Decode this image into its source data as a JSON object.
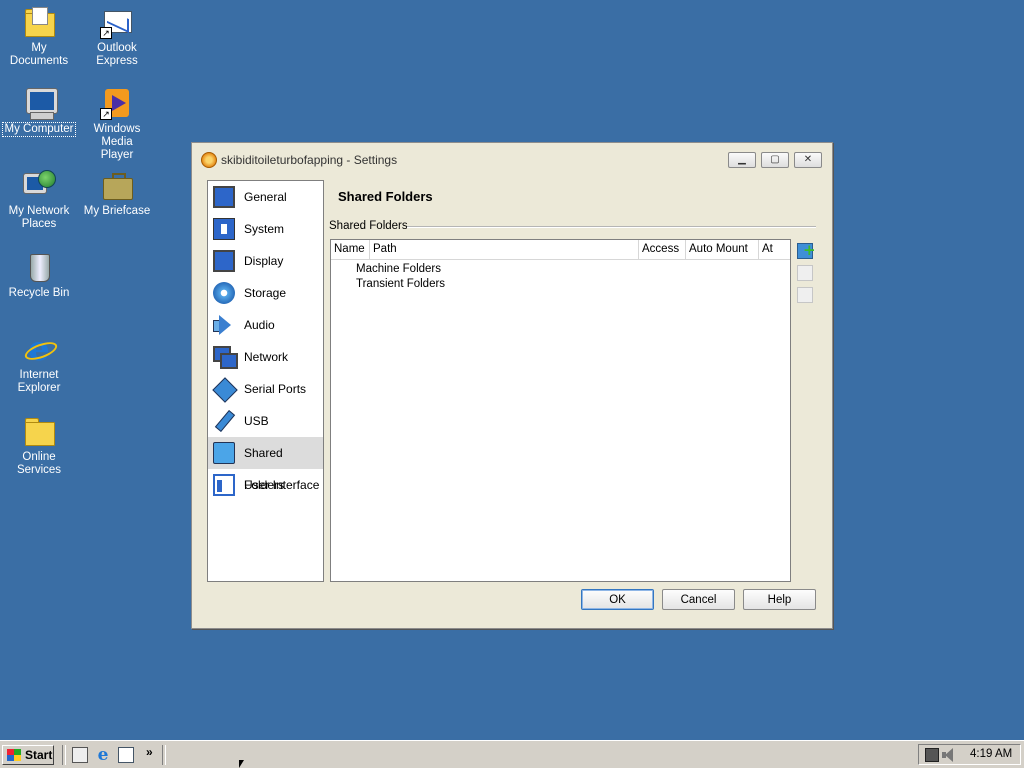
{
  "desktop": {
    "icons": [
      {
        "label": "My Documents"
      },
      {
        "label": "Outlook Express"
      },
      {
        "label": "My Computer"
      },
      {
        "label": "Windows Media Player"
      },
      {
        "label": "My Network Places"
      },
      {
        "label": "My Briefcase"
      },
      {
        "label": "Recycle Bin"
      },
      {
        "label": "Internet Explorer"
      },
      {
        "label": "Online Services"
      }
    ]
  },
  "dialog": {
    "title": "skibiditoileturbofapping - Settings",
    "sidebar": [
      {
        "label": "General",
        "icon": "general-icon"
      },
      {
        "label": "System",
        "icon": "system-icon"
      },
      {
        "label": "Display",
        "icon": "display-icon"
      },
      {
        "label": "Storage",
        "icon": "storage-icon"
      },
      {
        "label": "Audio",
        "icon": "audio-icon"
      },
      {
        "label": "Network",
        "icon": "network-icon"
      },
      {
        "label": "Serial Ports",
        "icon": "serial-ports-icon"
      },
      {
        "label": "USB",
        "icon": "usb-icon"
      },
      {
        "label": "Shared Folders",
        "icon": "shared-folders-icon",
        "selected": true
      },
      {
        "label": "User Interface",
        "icon": "user-interface-icon"
      }
    ],
    "section_title": "Shared Folders",
    "group_label": "Shared Folders",
    "table": {
      "columns": [
        "Name",
        "Path",
        "Access",
        "Auto Mount",
        "At"
      ],
      "rows": [
        "Machine Folders",
        "Transient Folders"
      ]
    },
    "buttons": {
      "ok": "OK",
      "cancel": "Cancel",
      "help": "Help"
    }
  },
  "taskbar": {
    "start_label": "Start",
    "more": "»",
    "clock": "4:19 AM"
  }
}
